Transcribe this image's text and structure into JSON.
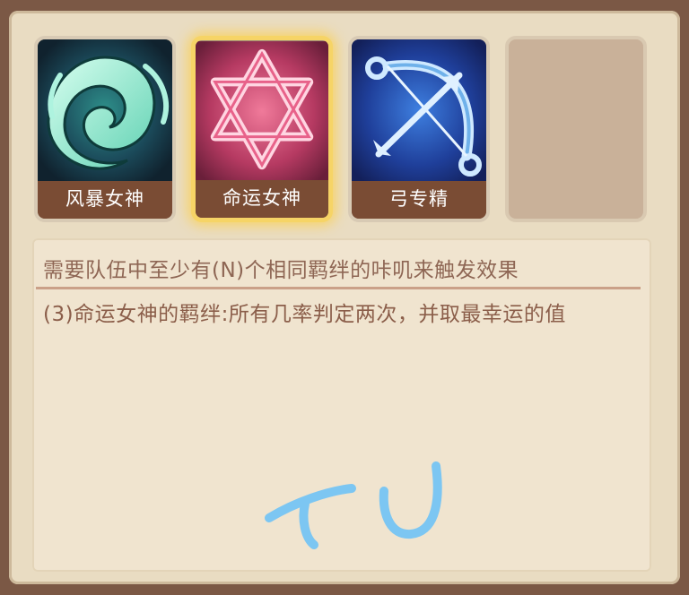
{
  "bonds": [
    {
      "label": "风暴女神",
      "icon": "storm-swirl-icon"
    },
    {
      "label": "命运女神",
      "icon": "hexagram-star-icon"
    },
    {
      "label": "弓专精",
      "icon": "bow-arrow-icon"
    },
    {
      "label": "",
      "icon": "empty-slot"
    }
  ],
  "requirement_text": "需要队伍中至少有(N)个相同羁绊的咔叽来触发效果",
  "description_text": "(3)命运女神的羁绊:所有几率判定两次，并取最幸运的值",
  "scribble_text": "TU",
  "colors": {
    "selected_glow": "#f6d466",
    "label_bg": "#7a4c34",
    "text": "#8b5e4a",
    "scribble": "#7cc6f2"
  }
}
